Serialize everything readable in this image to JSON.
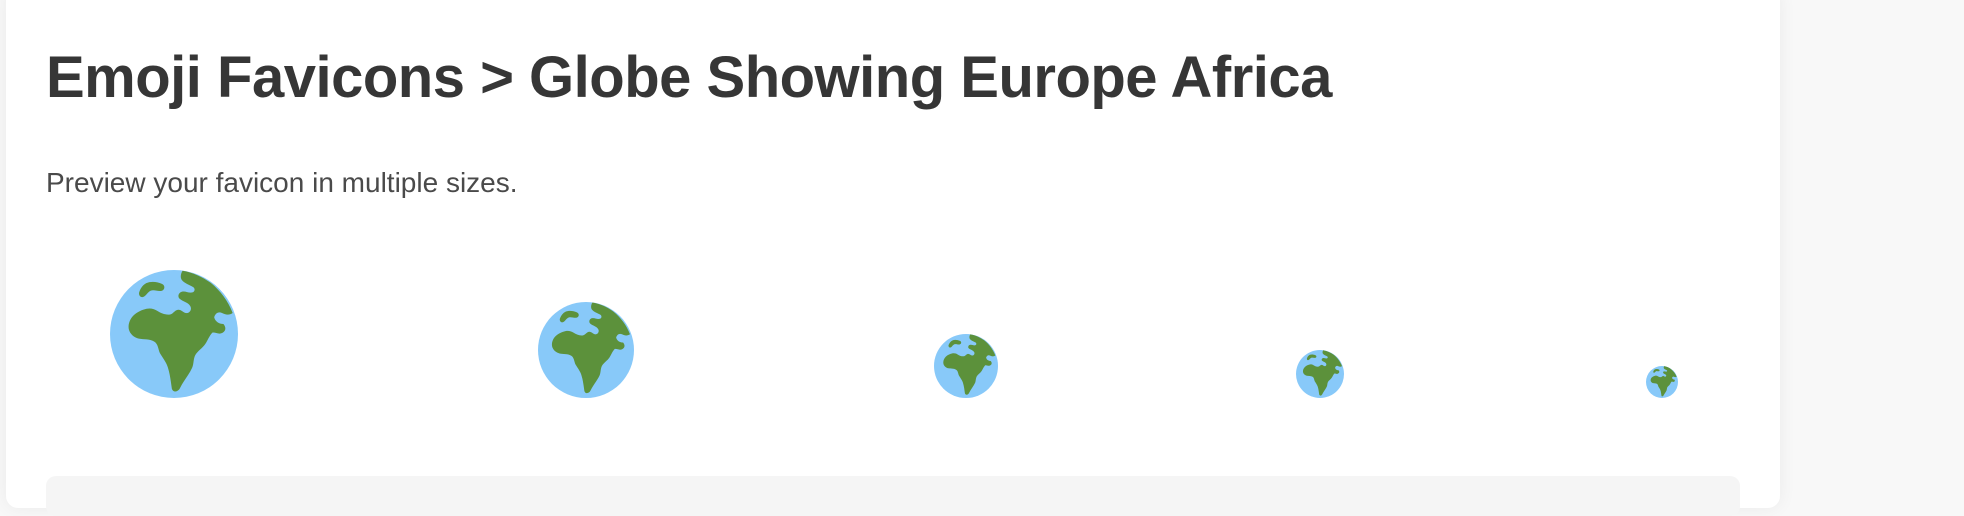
{
  "page": {
    "title": "Emoji Favicons > Globe Showing Europe Africa",
    "subtitle": "Preview your favicon in multiple sizes."
  },
  "preview": {
    "icon": "globe-showing-europe-africa-icon",
    "sizes": [
      128,
      96,
      64,
      48,
      32
    ]
  },
  "colors": {
    "ocean": "#88c9f9",
    "land": "#5c913b",
    "text": "#363636",
    "card": "#ffffff",
    "background": "#f8f8f8",
    "panel": "#f5f5f5"
  }
}
